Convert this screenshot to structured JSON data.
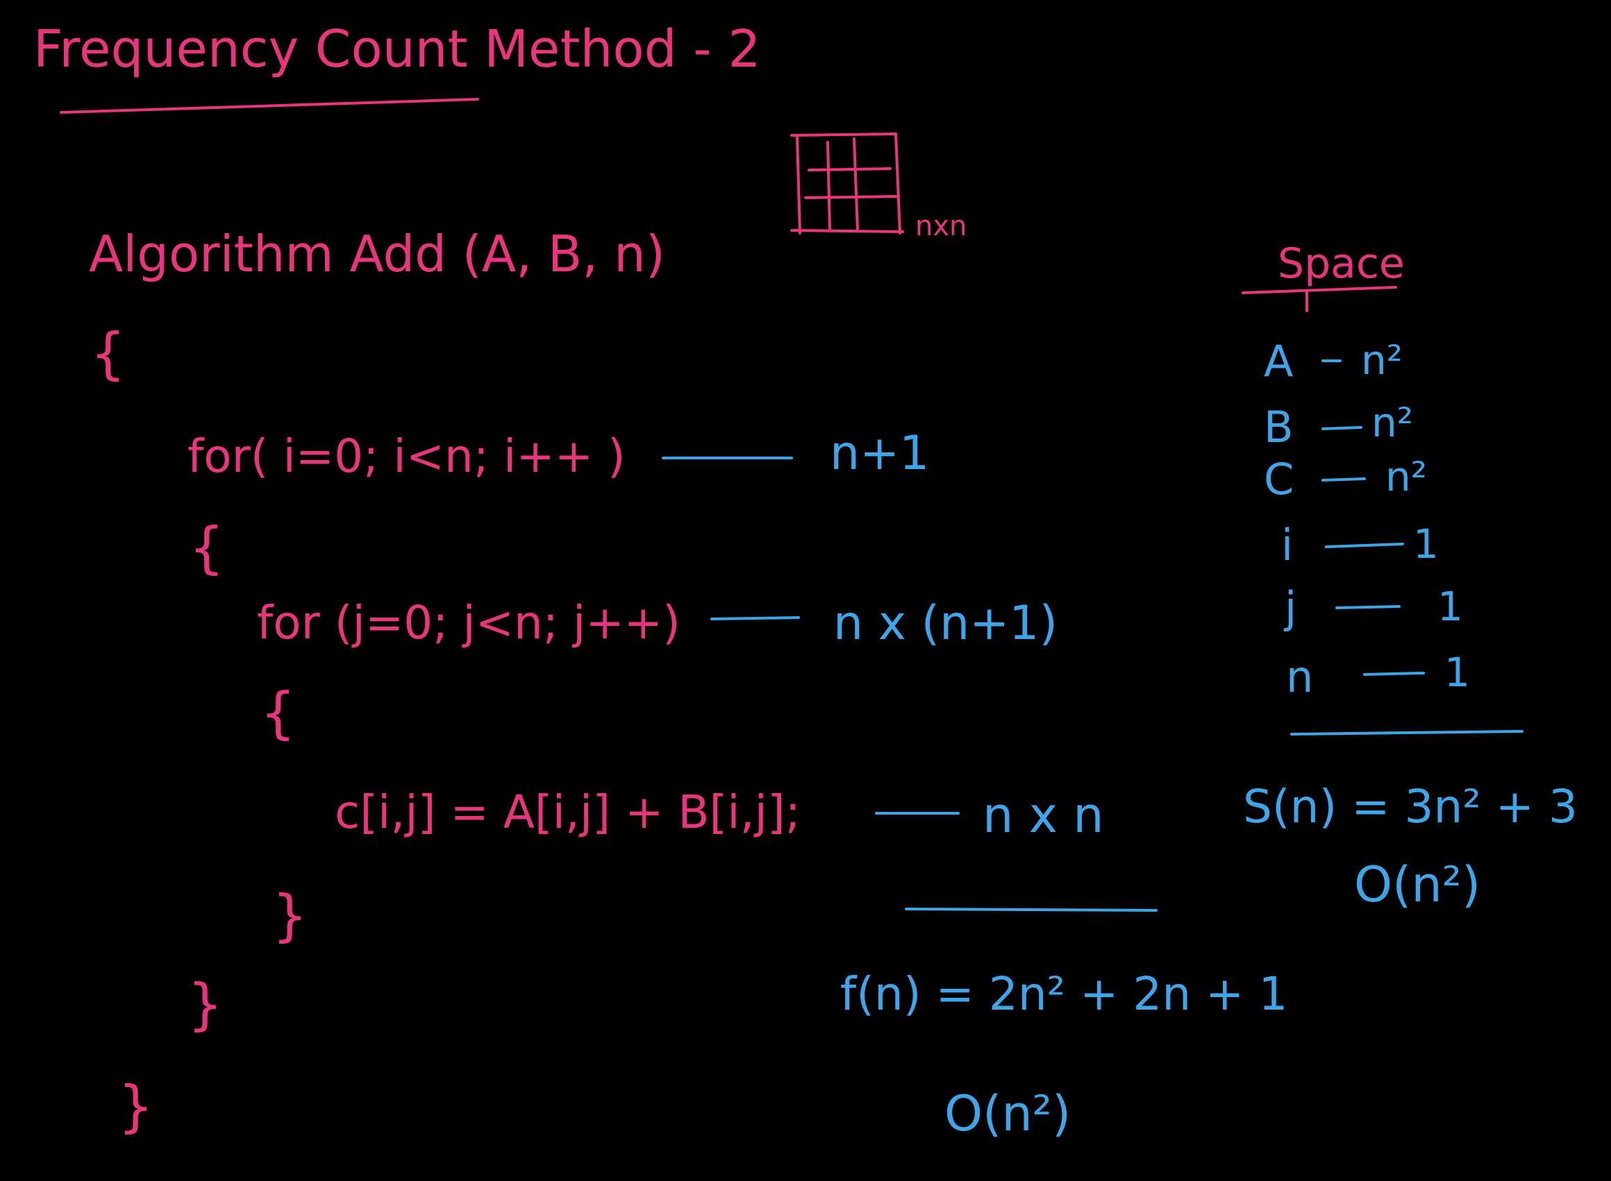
{
  "title": "Frequency Count Method - 2",
  "grid_label": "nxn",
  "algorithm": {
    "header": "Algorithm Add (A, B, n)",
    "open_brace": "{",
    "outer_loop": "for( i=0; i<n; i++ )",
    "outer_loop_count": "n+1",
    "outer_open_brace": "{",
    "inner_loop": "for (j=0; j<n; j++)",
    "inner_loop_count": "n x (n+1)",
    "inner_open_brace": "{",
    "statement": "c[i,j] = A[i,j] + B[i,j];",
    "statement_count": "n x n",
    "inner_close_brace": "}",
    "outer_close_brace": "}",
    "close_brace": "}"
  },
  "time": {
    "function": "f(n) = 2n² + 2n + 1",
    "order": "O(n²)"
  },
  "space": {
    "title": "Space",
    "items": [
      {
        "var": "A",
        "size": "n²"
      },
      {
        "var": "B",
        "size": "n²"
      },
      {
        "var": "C",
        "size": "n²"
      },
      {
        "var": "i",
        "size": "1"
      },
      {
        "var": "j",
        "size": "1"
      },
      {
        "var": "n",
        "size": "1"
      }
    ],
    "function": "S(n) = 3n² + 3",
    "order": "O(n²)"
  },
  "colors": {
    "background": "#000000",
    "pink_ink": "#e8357e",
    "blue_ink": "#3ea6e8"
  }
}
